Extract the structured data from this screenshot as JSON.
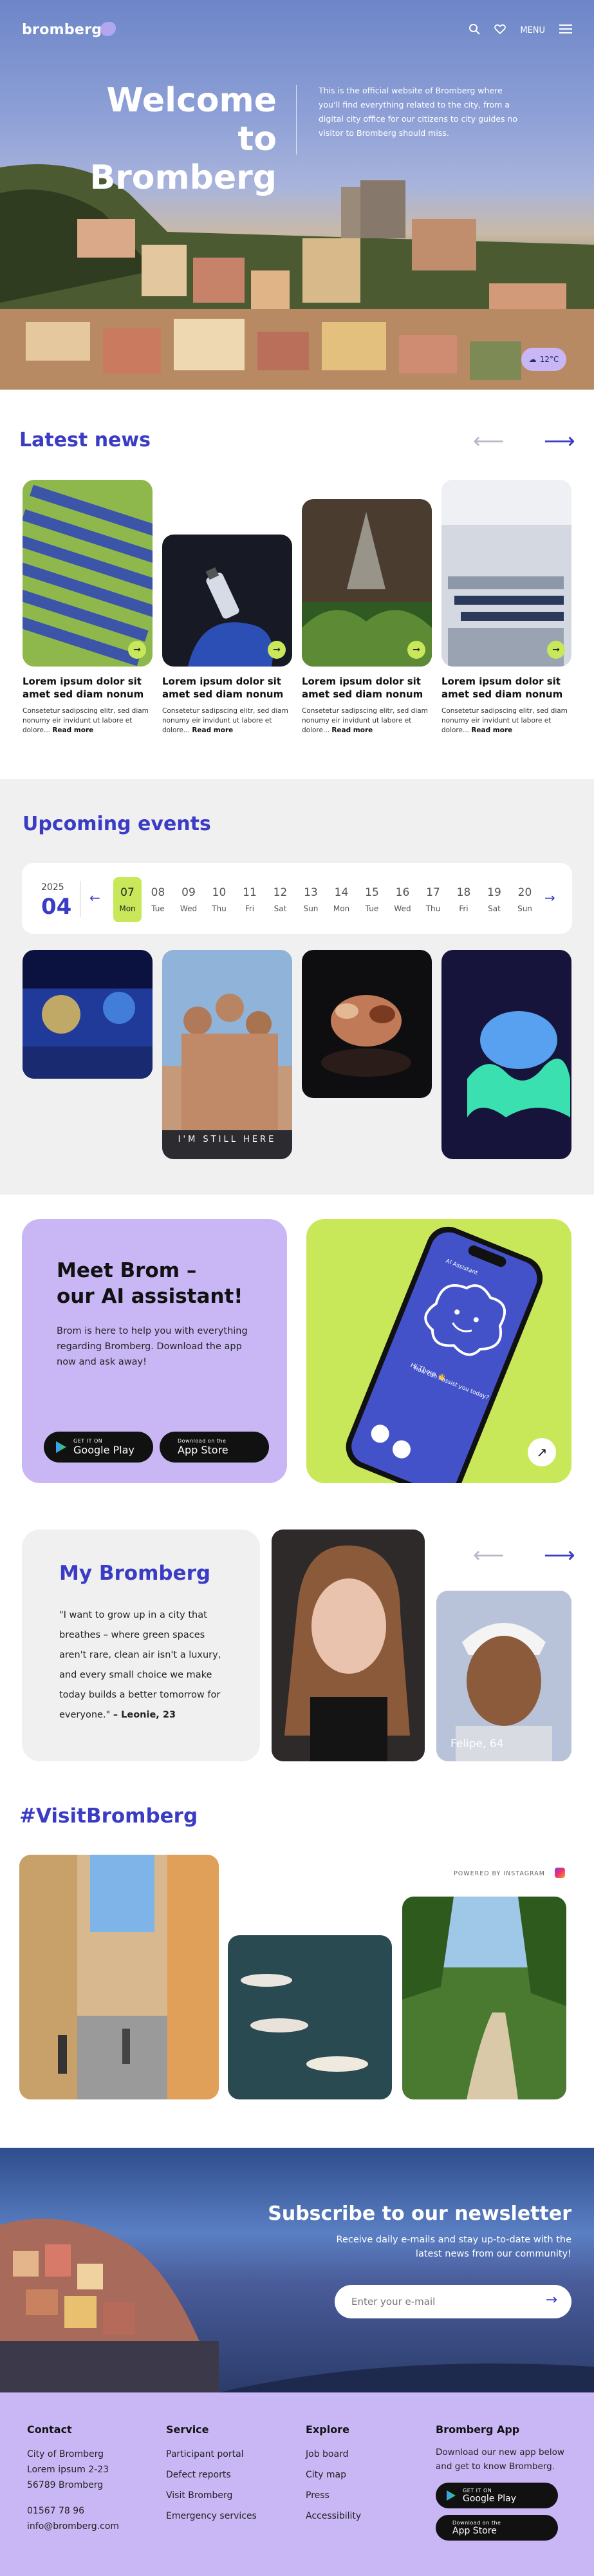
{
  "header": {
    "logo_text": "bromberg",
    "menu_label": "MENU"
  },
  "hero": {
    "title_line1": "Welcome to",
    "title_line2": "Bromberg",
    "text": "This is the official website of Bromberg where you'll find everything related to the city, from a digital city office for our citizens to city guides no visitor to Bromberg should miss.",
    "temperature": "12°C"
  },
  "news": {
    "heading": "Latest news",
    "items": [
      {
        "title": "Lorem ipsum dolor sit amet sed diam nonum",
        "text": "Consetetur sadipscing elitr, sed diam nonumy eir invidunt ut labore et dolore...",
        "more": "Read more"
      },
      {
        "title": "Lorem ipsum dolor sit amet sed diam nonum",
        "text": "Consetetur sadipscing elitr, sed diam nonumy eir invidunt ut labore et dolore...",
        "more": "Read more"
      },
      {
        "title": "Lorem ipsum dolor sit amet sed diam nonum",
        "text": "Consetetur sadipscing elitr, sed diam nonumy eir invidunt ut labore et dolore...",
        "more": "Read more"
      },
      {
        "title": "Lorem ipsum dolor sit amet sed diam nonum",
        "text": "Consetetur sadipscing elitr, sed diam nonumy eir invidunt ut labore et dolore...",
        "more": "Read more"
      }
    ]
  },
  "events": {
    "heading": "Upcoming events",
    "year": "2025",
    "month": "04",
    "days": [
      {
        "num": "07",
        "wd": "Mon"
      },
      {
        "num": "08",
        "wd": "Tue"
      },
      {
        "num": "09",
        "wd": "Wed"
      },
      {
        "num": "10",
        "wd": "Thu"
      },
      {
        "num": "11",
        "wd": "Fri"
      },
      {
        "num": "12",
        "wd": "Sat"
      },
      {
        "num": "13",
        "wd": "Sun"
      },
      {
        "num": "14",
        "wd": "Mon"
      },
      {
        "num": "15",
        "wd": "Tue"
      },
      {
        "num": "16",
        "wd": "Wed"
      },
      {
        "num": "17",
        "wd": "Thu"
      },
      {
        "num": "18",
        "wd": "Fri"
      },
      {
        "num": "19",
        "wd": "Sat"
      },
      {
        "num": "20",
        "wd": "Sun"
      }
    ],
    "poster_text": "I'M STILL HERE"
  },
  "brom": {
    "heading_line1": "Meet Brom –",
    "heading_line2": "our AI assistant!",
    "text": "Brom is here to help you with everything regarding Bromberg. Download the app now and ask away!",
    "google_small": "GET IT ON",
    "google_label": "Google Play",
    "apple_small": "Download on the",
    "apple_label": "App Store",
    "phone_header": "AI Assistant",
    "phone_greeting": "Hi There 👋",
    "phone_question": "How can I assist you today?"
  },
  "my_bromberg": {
    "heading": "My Bromberg",
    "quote": "\"I want to grow up in a city that breathes – where green spaces aren't rare, clean air isn't a luxury, and every small choice we make today builds a better tomorrow for everyone.\"",
    "author": "– Leonie, 23",
    "second_person": "Felipe, 64"
  },
  "visit": {
    "heading": "#VisitBromberg",
    "powered": "POWERED BY INSTAGRAM"
  },
  "newsletter": {
    "heading": "Subscribe to our newsletter",
    "text": "Receive daily e-mails and stay up-to-date with the latest news from our community!",
    "placeholder": "Enter your e-mail"
  },
  "footer": {
    "contact_heading": "Contact",
    "contact_lines": [
      "City of Bromberg",
      "Lorem ipsum 2-23",
      "56789 Bromberg",
      "01567 78 96",
      "info@bromberg.com"
    ],
    "service_heading": "Service",
    "service_links": [
      "Participant portal",
      "Defect reports",
      "Visit Bromberg",
      "Emergency services"
    ],
    "explore_heading": "Explore",
    "explore_links": [
      "Job board",
      "City map",
      "Press",
      "Accessibility"
    ],
    "app_heading": "Bromberg App",
    "app_text": "Download our new app below and get to know Bromberg.",
    "google_small": "GET IT ON",
    "google_label": "Google Play",
    "apple_small": "Download on the",
    "apple_label": "App Store"
  },
  "colors": {
    "accent_blue": "#3b3cc4",
    "lavender": "#c9b7f5",
    "lime": "#c8e85a"
  }
}
